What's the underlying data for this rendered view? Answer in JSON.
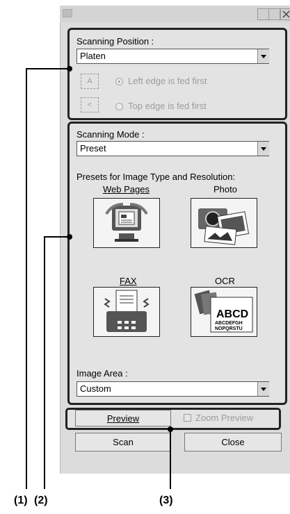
{
  "scan_position_group": {
    "label": "Scanning Position :",
    "select_value": "Platen",
    "radio1_label": "Left edge is fed first",
    "radio2_label": "Top edge is fed first"
  },
  "mode_group": {
    "label": "Scanning Mode :",
    "select_value": "Preset",
    "presets_label": "Presets for Image Type and Resolution:",
    "presets": [
      {
        "label": "Web Pages"
      },
      {
        "label": "Photo"
      },
      {
        "label": "FAX"
      },
      {
        "label": "OCR",
        "icon_text": [
          "ABCD",
          "ABCDEFGH",
          "NOPQRSTU"
        ]
      }
    ],
    "image_area_label": "Image Area :",
    "image_area_value": "Custom"
  },
  "preview_group": {
    "preview_label": "Preview",
    "zoom_label": "Zoom Preview"
  },
  "buttons": {
    "scan": "Scan",
    "close": "Close"
  },
  "callouts": [
    "(1)",
    "(2)",
    "(3)"
  ]
}
